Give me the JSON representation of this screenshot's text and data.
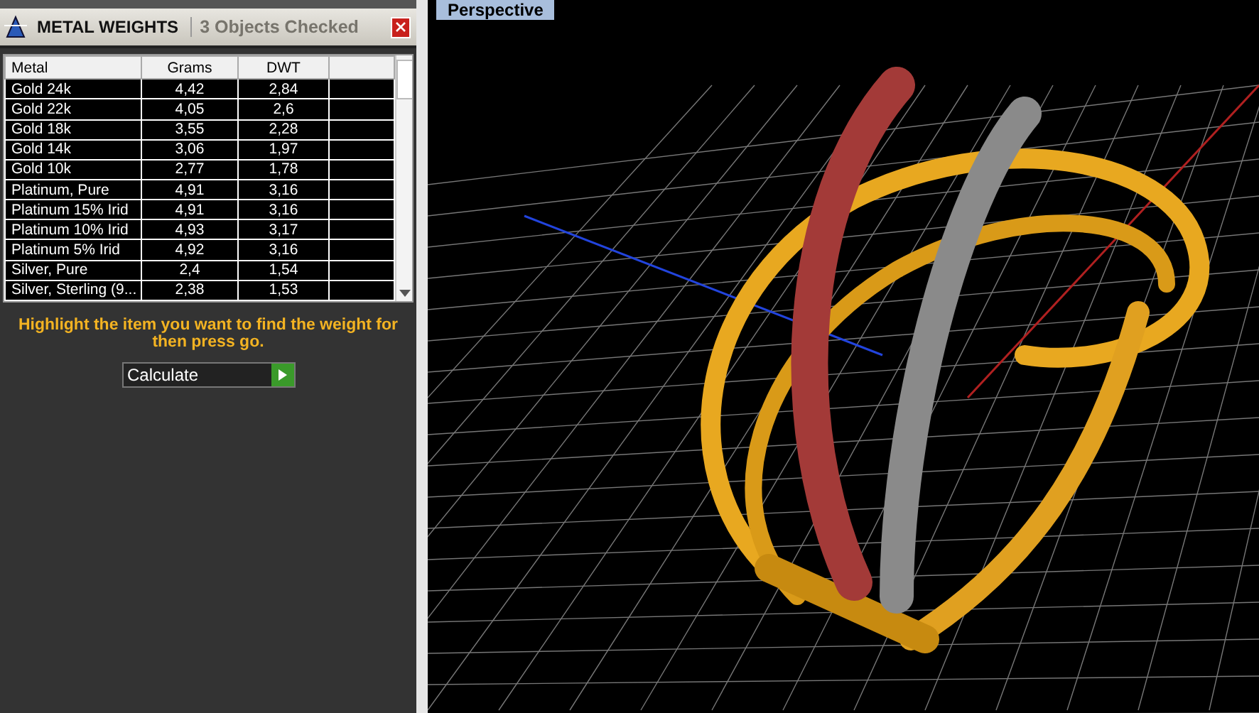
{
  "panel": {
    "title": "METAL WEIGHTS",
    "status": "3 Objects Checked"
  },
  "table": {
    "columns": [
      "Metal",
      "Grams",
      "DWT"
    ],
    "rows": [
      {
        "metal": "Gold 24k",
        "grams": "4,42",
        "dwt": "2,84",
        "selected": true
      },
      {
        "metal": "Gold 22k",
        "grams": "4,05",
        "dwt": "2,6",
        "selected": true
      },
      {
        "metal": "Gold 18k",
        "grams": "3,55",
        "dwt": "2,28",
        "selected": true
      },
      {
        "metal": "Gold 14k",
        "grams": "3,06",
        "dwt": "1,97",
        "selected": true
      },
      {
        "metal": "Gold 10k",
        "grams": "2,77",
        "dwt": "1,78",
        "selected": true
      },
      {
        "metal": "Platinum, Pure",
        "grams": "4,91",
        "dwt": "3,16",
        "selected": true
      },
      {
        "metal": "Platinum 15% Irid",
        "grams": "4,91",
        "dwt": "3,16",
        "selected": true
      },
      {
        "metal": "Platinum 10% Irid",
        "grams": "4,93",
        "dwt": "3,17",
        "selected": true
      },
      {
        "metal": "Platinum 5% Irid",
        "grams": "4,92",
        "dwt": "3,16",
        "selected": true
      },
      {
        "metal": "Silver, Pure",
        "grams": "2,4",
        "dwt": "1,54",
        "selected": true
      },
      {
        "metal": "Silver, Sterling (9...",
        "grams": "2,38",
        "dwt": "1,53",
        "selected": true
      }
    ]
  },
  "instruction": "Highlight the item you want to find the weight for then press go.",
  "action": {
    "value": "Calculate"
  },
  "viewport": {
    "label": "Perspective"
  }
}
